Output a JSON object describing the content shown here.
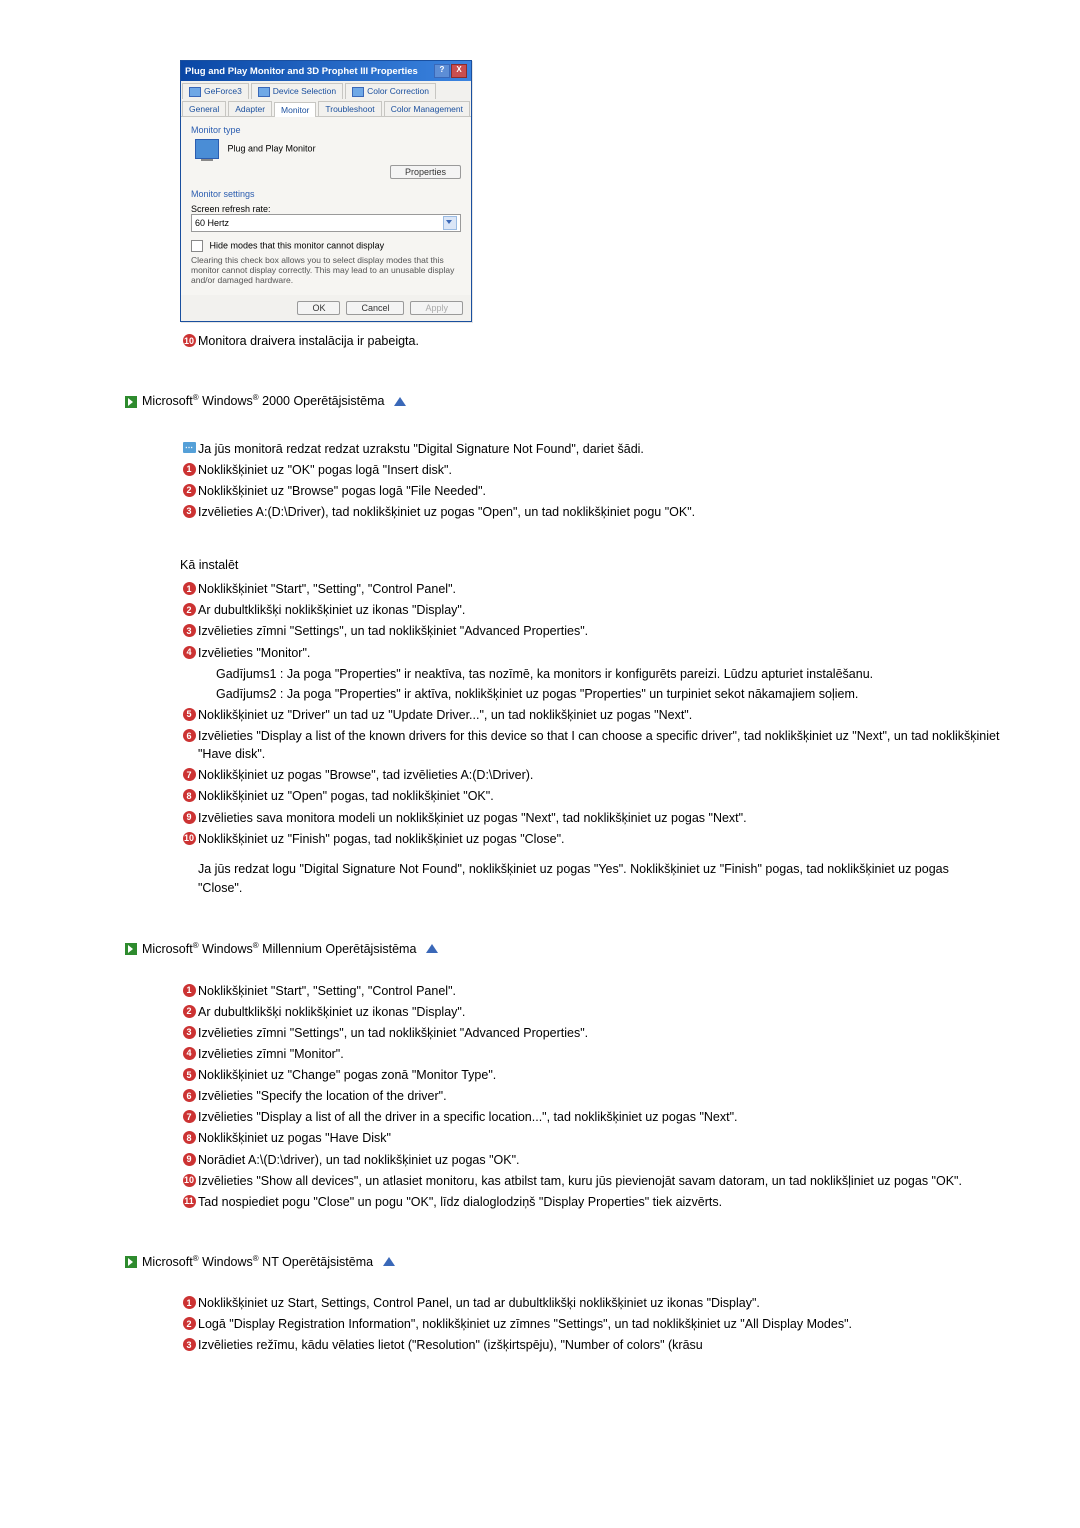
{
  "dialog": {
    "title": "Plug and Play Monitor and 3D Prophet III Properties",
    "help_btn": "?",
    "close_btn": "X",
    "tabs_row1": [
      "GeForce3",
      "Device Selection",
      "Color Correction"
    ],
    "tabs_row2": [
      "General",
      "Adapter",
      "Monitor",
      "Troubleshoot",
      "Color Management"
    ],
    "monitor_type_label": "Monitor type",
    "monitor_name": "Plug and Play Monitor",
    "properties_btn": "Properties",
    "settings_label": "Monitor settings",
    "refresh_label": "Screen refresh rate:",
    "refresh_value": "60 Hertz",
    "hide_modes": "Hide modes that this monitor cannot display",
    "hide_note": "Clearing this check box allows you to select display modes that this monitor cannot display correctly. This may lead to an unusable display and/or damaged hardware.",
    "ok": "OK",
    "cancel": "Cancel",
    "apply": "Apply"
  },
  "after_dialog_step": "Monitora draivera instalācija ir pabeigta.",
  "w2000": {
    "title_parts": [
      "Microsoft",
      " Windows",
      " 2000 Operētājsistēma"
    ],
    "info": "Ja jūs monitorā redzat redzat uzrakstu \"Digital Signature Not Found\", dariet šādi.",
    "pre_steps": [
      "Noklikšķiniet uz \"OK\" pogas logā \"Insert disk\".",
      "Noklikšķiniet uz \"Browse\" pogas logā \"File Needed\".",
      "Izvēlieties A:(D:\\Driver), tad noklikšķiniet uz pogas \"Open\", un tad noklikšķiniet pogu \"OK\"."
    ],
    "howto": "Kā instalēt",
    "steps": [
      "Noklikšķiniet \"Start\", \"Setting\", \"Control Panel\".",
      "Ar dubultklikšķi noklikšķiniet uz ikonas \"Display\".",
      "Izvēlieties zīmni \"Settings\", un tad noklikšķiniet \"Advanced Properties\".",
      "Izvēlieties \"Monitor\"."
    ],
    "case1": "Gadījums1 : Ja poga \"Properties\" ir neaktīva, tas nozīmē, ka monitors ir konfigurēts pareizi. Lūdzu apturiet instalēšanu.",
    "case2": "Gadījums2 : Ja poga \"Properties\" ir aktīva, noklikšķiniet uz pogas \"Properties\" un turpiniet sekot nākamajiem soļiem.",
    "steps_b": [
      "Noklikšķiniet uz \"Driver\" un tad uz \"Update Driver...\", un tad noklikšķiniet uz pogas \"Next\".",
      "Izvēlieties \"Display a list of the known drivers for this device so that I can choose a specific driver\", tad noklikšķiniet uz \"Next\", un tad noklikšķiniet \"Have disk\".",
      "Noklikšķiniet uz pogas \"Browse\", tad izvēlieties A:(D:\\Driver).",
      "Noklikšķiniet uz \"Open\" pogas, tad noklikšķiniet \"OK\".",
      "Izvēlieties sava monitora modeli un noklikšķiniet uz pogas \"Next\", tad noklikšķiniet uz pogas \"Next\".",
      "Noklikšķiniet uz \"Finish\" pogas, tad noklikšķiniet uz pogas \"Close\"."
    ],
    "closing": "Ja jūs redzat logu \"Digital Signature Not Found\", noklikšķiniet uz pogas \"Yes\". Noklikšķiniet uz \"Finish\" pogas, tad noklikšķiniet uz pogas \"Close\"."
  },
  "wme": {
    "title_parts": [
      "Microsoft",
      " Windows",
      " Millennium Operētājsistēma"
    ],
    "steps": [
      "Noklikšķiniet \"Start\", \"Setting\", \"Control Panel\".",
      "Ar dubultklikšķi noklikšķiniet uz ikonas \"Display\".",
      "Izvēlieties zīmni \"Settings\", un tad noklikšķiniet \"Advanced Properties\".",
      "Izvēlieties zīmni \"Monitor\".",
      "Noklikšķiniet uz \"Change\" pogas zonā \"Monitor Type\".",
      "Izvēlieties \"Specify the location of the driver\".",
      "Izvēlieties \"Display a list of all the driver in a specific location...\", tad noklikšķiniet uz pogas \"Next\".",
      "Noklikšķiniet uz pogas \"Have Disk\"",
      "Norādiet A:\\(D:\\driver), un tad noklikšķiniet uz pogas \"OK\".",
      "Izvēlieties \"Show all devices\", un atlasiet monitoru, kas atbilst tam, kuru jūs pievienojāt savam datoram, un tad noklikšļiniet uz pogas \"OK\".",
      "Tad nospiediet pogu \"Close\" un pogu \"OK\", līdz dialoglodziņš \"Display Properties\" tiek aizvērts."
    ]
  },
  "wnt": {
    "title_parts": [
      "Microsoft",
      " Windows",
      " NT Operētājsistēma"
    ],
    "steps": [
      "Noklikšķiniet uz Start, Settings, Control Panel, un tad ar dubultklikšķi noklikšķiniet uz ikonas \"Display\".",
      "Logā \"Display Registration Information\", noklikšķiniet uz zīmnes \"Settings\", un tad noklikšķiniet uz \"All Display Modes\".",
      "Izvēlieties režīmu, kādu vēlaties lietot (\"Resolution\" (izšķirtspēju), \"Number of colors\" (krāsu"
    ]
  }
}
